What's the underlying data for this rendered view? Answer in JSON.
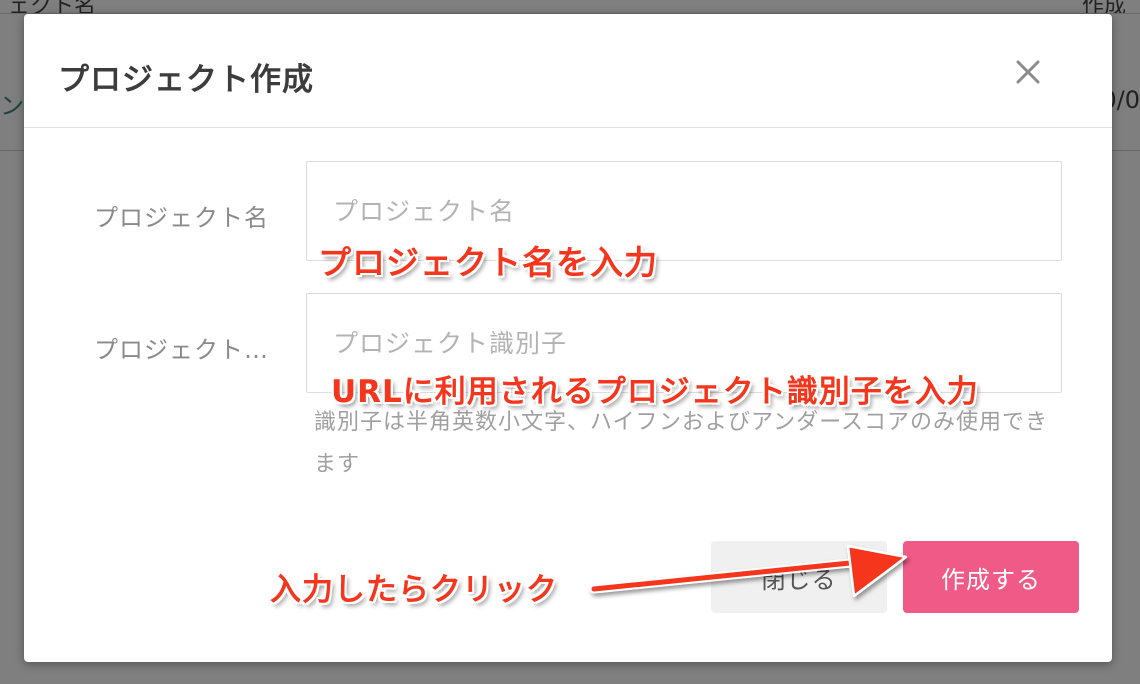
{
  "background": {
    "header_col_name": "ェクト名",
    "header_col_created": "作成",
    "row_left_fragment": "ン",
    "row_right_fragment": "0/0"
  },
  "modal": {
    "title": "プロジェクト作成",
    "close_icon": "close-icon",
    "fields": [
      {
        "label": "プロジェクト名",
        "value": "",
        "placeholder": "プロジェクト名"
      },
      {
        "label": "プロジェクト…",
        "value": "",
        "placeholder": "プロジェクト識別子"
      }
    ],
    "help_text": "識別子は半角英数小文字、ハイフンおよびアンダースコアのみ使用できます",
    "buttons": {
      "close_label": "閉じる",
      "create_label": "作成する"
    }
  },
  "annotations": {
    "name_hint": "プロジェクト名を入力",
    "identifier_hint": "URLに利用されるプロジェクト識別子を入力",
    "click_hint": "入力したらクリック"
  },
  "colors": {
    "accent": "#ef5a86",
    "annotation": "#f5351c"
  }
}
